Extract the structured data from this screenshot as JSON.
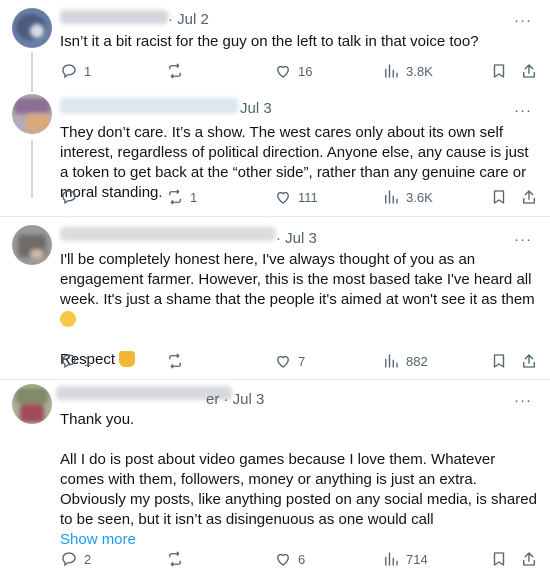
{
  "replies": [
    {
      "date": "· Jul 2",
      "text": [
        "Isn’t it a bit racist for the guy on the left to talk in that voice too?"
      ],
      "stats": {
        "replies": "1",
        "reposts": "",
        "likes": "16",
        "views": "3.8K"
      }
    },
    {
      "date": "Jul 3",
      "text": [
        "They don’t care. It’s a show. The west cares only about its own self interest, regardless of political direction. Anyone else, any cause is just a token to get back at the “other side”, rather than any genuine care or moral standing."
      ],
      "stats": {
        "replies": "",
        "reposts": "1",
        "likes": "111",
        "views": "3.6K"
      }
    },
    {
      "date": "· Jul 3",
      "text": [
        "I'll be completely honest here, I've always thought of you as an engagement farmer. However, this is the most based take I've heard all week. It's just a shame that the people it's aimed at won't see it as them",
        "Respect"
      ],
      "stats": {
        "replies": "1",
        "reposts": "",
        "likes": "7",
        "views": "882"
      }
    },
    {
      "date": "er · Jul 3",
      "text": [
        "Thank you.",
        "All I do is post about video games because I love them. Whatever comes with them, followers, money or anything is just an extra. Obviously my posts, like anything posted on any social media, is shared to be seen, but it isn’t as disingenuous as one would call"
      ],
      "show_more": "Show more",
      "stats": {
        "replies": "2",
        "reposts": "",
        "likes": "6",
        "views": "714"
      }
    }
  ],
  "more_label": "···",
  "emoji": {
    "pensive": "🙁",
    "pray": "🙏"
  }
}
